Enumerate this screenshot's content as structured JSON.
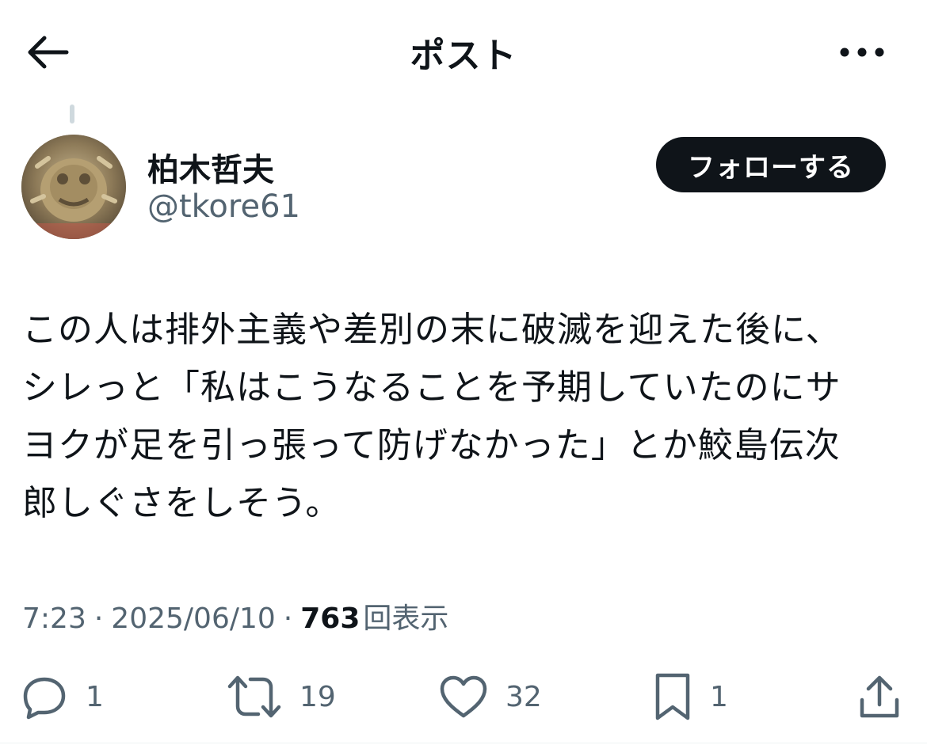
{
  "header": {
    "title": "ポスト",
    "back_icon": "arrow-left-icon",
    "more_icon": "more-horizontal-icon"
  },
  "author": {
    "name": "柏木哲夫",
    "handle": "@tkore61",
    "follow_label": "フォローする"
  },
  "post": {
    "lines": [
      "この人は排外主義や差別の末に破滅を迎えた後に、",
      "シレっと「私はこうなることを予期していたのにサ",
      "ヨクが足を引っ張って防げなかった」とか鮫島伝次",
      "郎しぐさをしそう。"
    ]
  },
  "meta": {
    "time": "7:23",
    "separator": "·",
    "date": "2025/06/10",
    "views_count": "763",
    "views_label": "回表示"
  },
  "actions": {
    "reply": {
      "icon": "reply-icon",
      "count": "1"
    },
    "repost": {
      "icon": "repost-icon",
      "count": "19"
    },
    "like": {
      "icon": "heart-icon",
      "count": "32"
    },
    "bookmark": {
      "icon": "bookmark-icon",
      "count": "1"
    },
    "share": {
      "icon": "share-icon"
    }
  },
  "colors": {
    "text_primary": "#0f1419",
    "text_secondary": "#536471",
    "follow_bg": "#0f1419",
    "follow_text": "#ffffff"
  }
}
